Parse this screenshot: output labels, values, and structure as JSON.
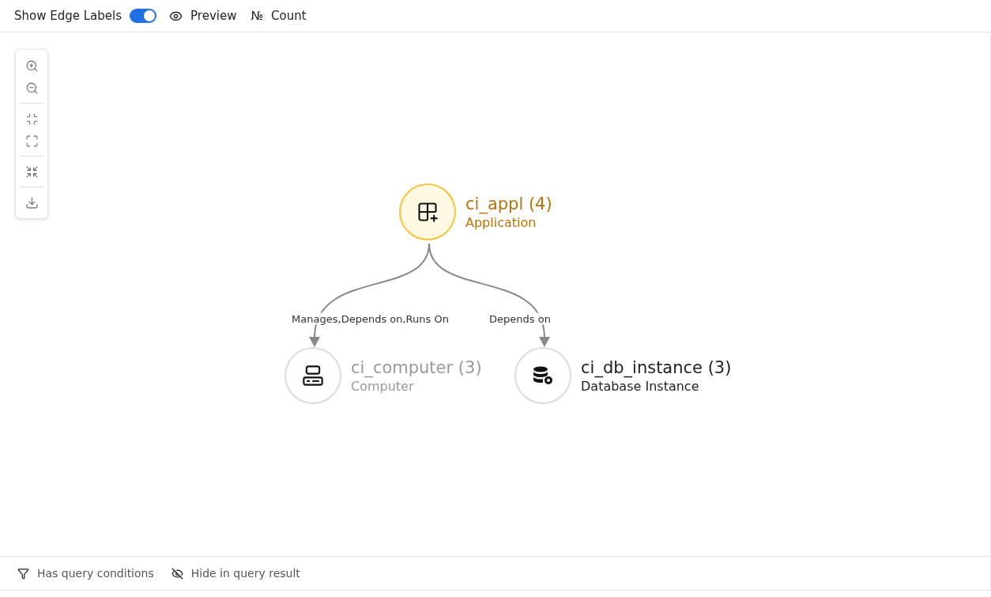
{
  "toolbar": {
    "edge_labels": {
      "label": "Show Edge Labels",
      "on": true
    },
    "preview": {
      "label": "Preview"
    },
    "count": {
      "symbol": "№",
      "label": "Count"
    }
  },
  "zoom_tools": [
    {
      "kind": "zoom-in"
    },
    {
      "kind": "zoom-out"
    },
    {
      "kind": "fit"
    },
    {
      "kind": "full"
    },
    {
      "kind": "shrink"
    },
    {
      "kind": "download"
    }
  ],
  "graph": {
    "nodes": [
      {
        "kind": "application",
        "name": "ci_appl (4)",
        "type": "Application",
        "selected": true,
        "dimmed": false
      },
      {
        "kind": "computer",
        "name": "ci_computer (3)",
        "type": "Computer",
        "selected": false,
        "dimmed": true
      },
      {
        "kind": "database",
        "name": "ci_db_instance (3)",
        "type": "Database Instance",
        "selected": false,
        "dimmed": false
      }
    ],
    "edges": [
      {
        "label": "Manages,Depends on,Runs On"
      },
      {
        "label": "Depends on"
      }
    ]
  },
  "legend": [
    {
      "kind": "filter",
      "label": "Has query conditions"
    },
    {
      "kind": "hidden",
      "label": "Hide in query result"
    }
  ]
}
